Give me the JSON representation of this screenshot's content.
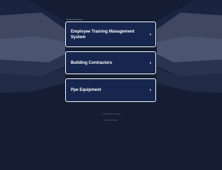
{
  "header": {
    "label": "Related searches"
  },
  "links": [
    {
      "label": "Employee Training Management System"
    },
    {
      "label": "Building Contractors"
    },
    {
      "label": "Ppe Equipment"
    }
  ],
  "footer": {
    "note": "© All rights reserved",
    "privacy_label": "Privacy Policy"
  },
  "colors": {
    "background": "#141d33",
    "card_background": "#16264f",
    "card_border": "#ffffff",
    "text": "#ffffff",
    "muted_text": "#6e7891"
  },
  "icons": {
    "card_arrow": "chevron-right-icon"
  }
}
